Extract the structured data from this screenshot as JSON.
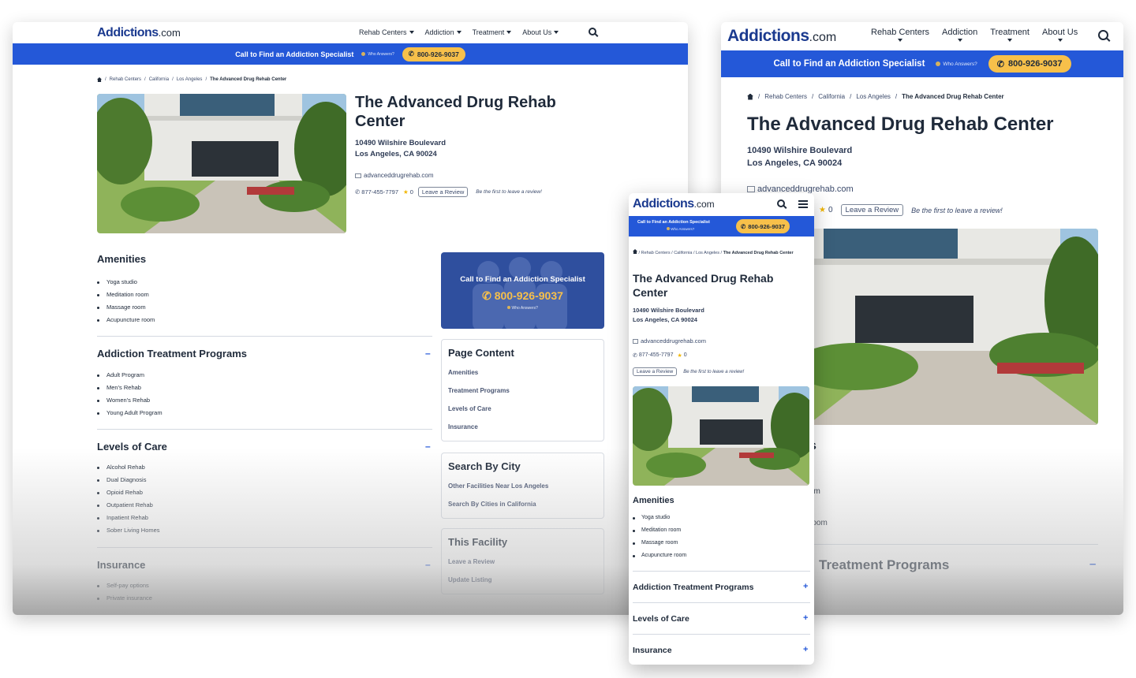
{
  "logo": {
    "main": "Addictions",
    "suffix": ".com"
  },
  "nav": {
    "rehab_centers": "Rehab Centers",
    "addiction": "Addiction",
    "treatment": "Treatment",
    "about_us": "About Us"
  },
  "banner": {
    "call_text": "Call to Find an Addiction Specialist",
    "who_answers": "Who Answers?",
    "phone": "800-926-9037"
  },
  "breadcrumb": {
    "c1": "Rehab Centers",
    "c2": "California",
    "c3": "Los Angeles",
    "c4": "The Advanced Drug Rehab Center",
    "sep": "/"
  },
  "facility": {
    "name": "The Advanced Drug Rehab Center",
    "name_line1": "The Advanced Drug Rehab",
    "name_line2": "Center",
    "street": "10490 Wilshire Boulevard",
    "city": "Los Angeles, CA 90024",
    "website": "advanceddrugrehab.com",
    "phone": "877-455-7797",
    "rating": "0",
    "review_button": "Leave a Review",
    "review_prompt": "Be the first to leave a review!"
  },
  "sections": {
    "amenities": {
      "title": "Amenities",
      "items": [
        "Yoga studio",
        "Meditation room",
        "Massage room",
        "Acupuncture room"
      ]
    },
    "programs": {
      "title": "Addiction Treatment Programs",
      "items": [
        "Adult Program",
        "Men's Rehab",
        "Women's Rehab",
        "Young Adult Program"
      ]
    },
    "levels": {
      "title": "Levels of Care",
      "items": [
        "Alcohol Rehab",
        "Dual Diagnosis",
        "Opioid Rehab",
        "Outpatient Rehab",
        "Inpatient Rehab",
        "Sober Living Homes"
      ]
    },
    "insurance": {
      "title": "Insurance",
      "items": [
        "Self-pay options",
        "Private insurance"
      ]
    }
  },
  "sidebar": {
    "cta_text": "Call to Find an Addiction Specialist",
    "cta_phone": "800-926-9037",
    "cta_who": "Who Answers?",
    "page_content": {
      "title": "Page Content",
      "links": [
        "Amenities",
        "Treatment Programs",
        "Levels of Care",
        "Insurance"
      ]
    },
    "search_city": {
      "title": "Search By City",
      "links": [
        "Other Facilities Near Los Angeles",
        "Search By Cities in California"
      ]
    },
    "this_facility": {
      "title": "This Facility",
      "links": [
        "Leave a Review",
        "Update Listing"
      ]
    }
  },
  "tablet_partial": {
    "amenities_tail": "s",
    "item_tail_1": "om",
    "item_tail_2": "n",
    "item_tail_3": "room",
    "programs_tail": "Treatment Programs",
    "last_tail": "n"
  },
  "accordion": {
    "collapse": "–",
    "expand": "+"
  },
  "colors": {
    "brand_blue": "#2458d8",
    "logo_blue": "#1b3a8f",
    "accent_yellow": "#f7c04a",
    "text_dark": "#1f2a3a"
  },
  "icons": [
    "home-icon",
    "search-icon",
    "menu-icon",
    "phone-icon",
    "star-icon",
    "web-icon",
    "info-icon"
  ]
}
